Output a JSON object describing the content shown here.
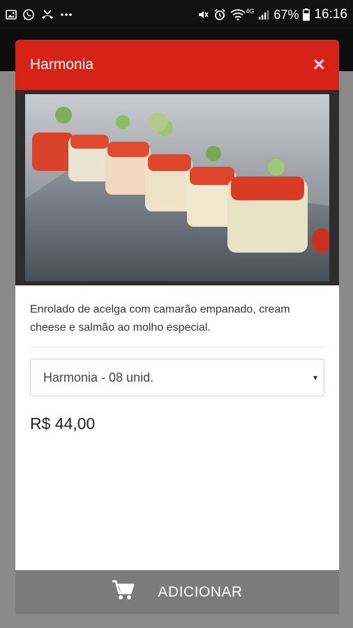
{
  "status_bar": {
    "battery": "67%",
    "time": "16:16",
    "network": "4G",
    "notifications": [
      "image-icon",
      "whatsapp-icon",
      "missed-call-icon",
      "more-dots-icon"
    ]
  },
  "modal": {
    "title": "Harmonia",
    "close_label": "×",
    "description": "Enrolado de acelga com camarão empanado, cream cheese e salmão ao molho especial.",
    "select": {
      "selected": "Harmonia - 08 unid.",
      "caret": "▾"
    },
    "price": "R$ 44,00",
    "add_button": "ADICIONAR"
  },
  "colors": {
    "header": "#d7221a",
    "footer": "#7b7b7b"
  }
}
